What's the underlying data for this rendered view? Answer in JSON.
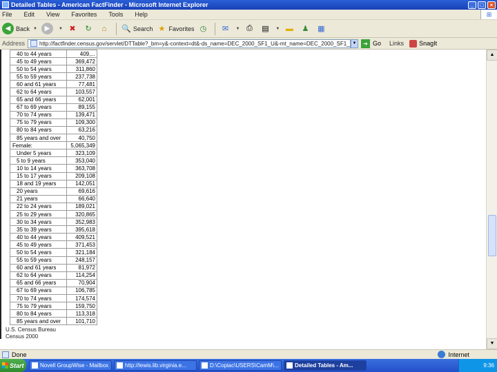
{
  "window": {
    "title": "Detailed Tables - American FactFinder - Microsoft Internet Explorer"
  },
  "menu": [
    "File",
    "Edit",
    "View",
    "Favorites",
    "Tools",
    "Help"
  ],
  "toolbar": {
    "back": "Back",
    "search": "Search",
    "favorites": "Favorites"
  },
  "address": {
    "label": "Address",
    "url": "http://factfinder.census.gov/servlet/DTTable?_bm=y&-context=dt&-ds_name=DEC_2000_SF1_U&-mt_name=DEC_2000_SF1_U_P012A",
    "go": "Go",
    "links": "Links",
    "snagit": "SnagIt"
  },
  "table": [
    {
      "label": "40 to 44 years",
      "value": "409,...",
      "total": false
    },
    {
      "label": "45 to 49 years",
      "value": "369,472",
      "total": false
    },
    {
      "label": "50 to 54 years",
      "value": "311,860",
      "total": false
    },
    {
      "label": "55 to 59 years",
      "value": "237,738",
      "total": false
    },
    {
      "label": "60 and 61 years",
      "value": "77,481",
      "total": false
    },
    {
      "label": "62 to 64 years",
      "value": "103,557",
      "total": false
    },
    {
      "label": "65 and 66 years",
      "value": "62,001",
      "total": false
    },
    {
      "label": "67 to 69 years",
      "value": "89,155",
      "total": false
    },
    {
      "label": "70 to 74 years",
      "value": "139,471",
      "total": false
    },
    {
      "label": "75 to 79 years",
      "value": "109,300",
      "total": false
    },
    {
      "label": "80 to 84 years",
      "value": "63,216",
      "total": false
    },
    {
      "label": "85 years and over",
      "value": "40,750",
      "total": false
    },
    {
      "label": "Female:",
      "value": "5,065,349",
      "total": true
    },
    {
      "label": "Under 5 years",
      "value": "323,109",
      "total": false
    },
    {
      "label": "5 to 9 years",
      "value": "353,040",
      "total": false
    },
    {
      "label": "10 to 14 years",
      "value": "363,708",
      "total": false
    },
    {
      "label": "15 to 17 years",
      "value": "209,108",
      "total": false
    },
    {
      "label": "18 and 19 years",
      "value": "142,051",
      "total": false
    },
    {
      "label": "20 years",
      "value": "69,616",
      "total": false
    },
    {
      "label": "21 years",
      "value": "66,640",
      "total": false
    },
    {
      "label": "22 to 24 years",
      "value": "189,021",
      "total": false
    },
    {
      "label": "25 to 29 years",
      "value": "320,865",
      "total": false
    },
    {
      "label": "30 to 34 years",
      "value": "352,983",
      "total": false
    },
    {
      "label": "35 to 39 years",
      "value": "395,618",
      "total": false
    },
    {
      "label": "40 to 44 years",
      "value": "409,521",
      "total": false
    },
    {
      "label": "45 to 49 years",
      "value": "371,453",
      "total": false
    },
    {
      "label": "50 to 54 years",
      "value": "321,184",
      "total": false
    },
    {
      "label": "55 to 59 years",
      "value": "248,157",
      "total": false
    },
    {
      "label": "60 and 61 years",
      "value": "81,972",
      "total": false
    },
    {
      "label": "62 to 64 years",
      "value": "114,254",
      "total": false
    },
    {
      "label": "65 and 66 years",
      "value": "70,904",
      "total": false
    },
    {
      "label": "67 to 69 years",
      "value": "106,785",
      "total": false
    },
    {
      "label": "70 to 74 years",
      "value": "174,574",
      "total": false
    },
    {
      "label": "75 to 79 years",
      "value": "159,750",
      "total": false
    },
    {
      "label": "80 to 84 years",
      "value": "113,318",
      "total": false
    },
    {
      "label": "85 years and over",
      "value": "101,710",
      "total": false
    }
  ],
  "source": {
    "line1": "U.S. Census Bureau",
    "line2": "Census 2000"
  },
  "status": {
    "text": "Done",
    "zone": "Internet"
  },
  "taskbar": {
    "start": "Start",
    "items": [
      {
        "label": "Novell GroupWise - Mailbox",
        "active": false
      },
      {
        "label": "http://lewis.lib.virginia.e...",
        "active": false
      },
      {
        "label": "D:\\Copiac\\USERS\\CamM\\...",
        "active": false
      },
      {
        "label": "Detailed Tables - Am...",
        "active": true
      }
    ],
    "clock": "9:36"
  }
}
